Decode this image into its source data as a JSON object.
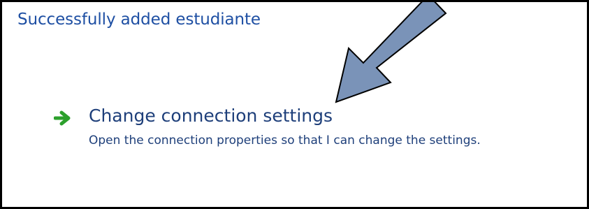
{
  "dialog": {
    "heading": "Successfully added estudiante"
  },
  "task": {
    "title": "Change connection settings",
    "description": "Open the connection properties so that I can change the settings.",
    "icon": "green-arrow-icon",
    "arrow_color": "#2ca02c"
  },
  "annotation": {
    "icon": "callout-arrow-icon",
    "fill_color": "#7a93b8"
  },
  "colors": {
    "heading_text": "#1e4fa3",
    "link_text": "#1e3f7a",
    "border": "#000000",
    "background": "#ffffff"
  }
}
